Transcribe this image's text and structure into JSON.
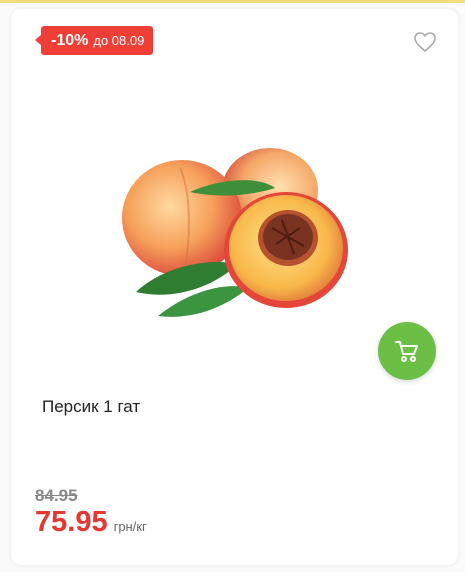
{
  "badge": {
    "percent": "-10%",
    "until": "до 08.09"
  },
  "icons": {
    "favorite": "heart-outline-icon",
    "cart": "shopping-cart-icon"
  },
  "product": {
    "name": "Персик 1 гат"
  },
  "price": {
    "old": "84.95",
    "current": "75.95",
    "unit": "грн/кг"
  },
  "colors": {
    "badge": "#ef3e36",
    "cart": "#6cbf45",
    "price": "#e8372f"
  }
}
